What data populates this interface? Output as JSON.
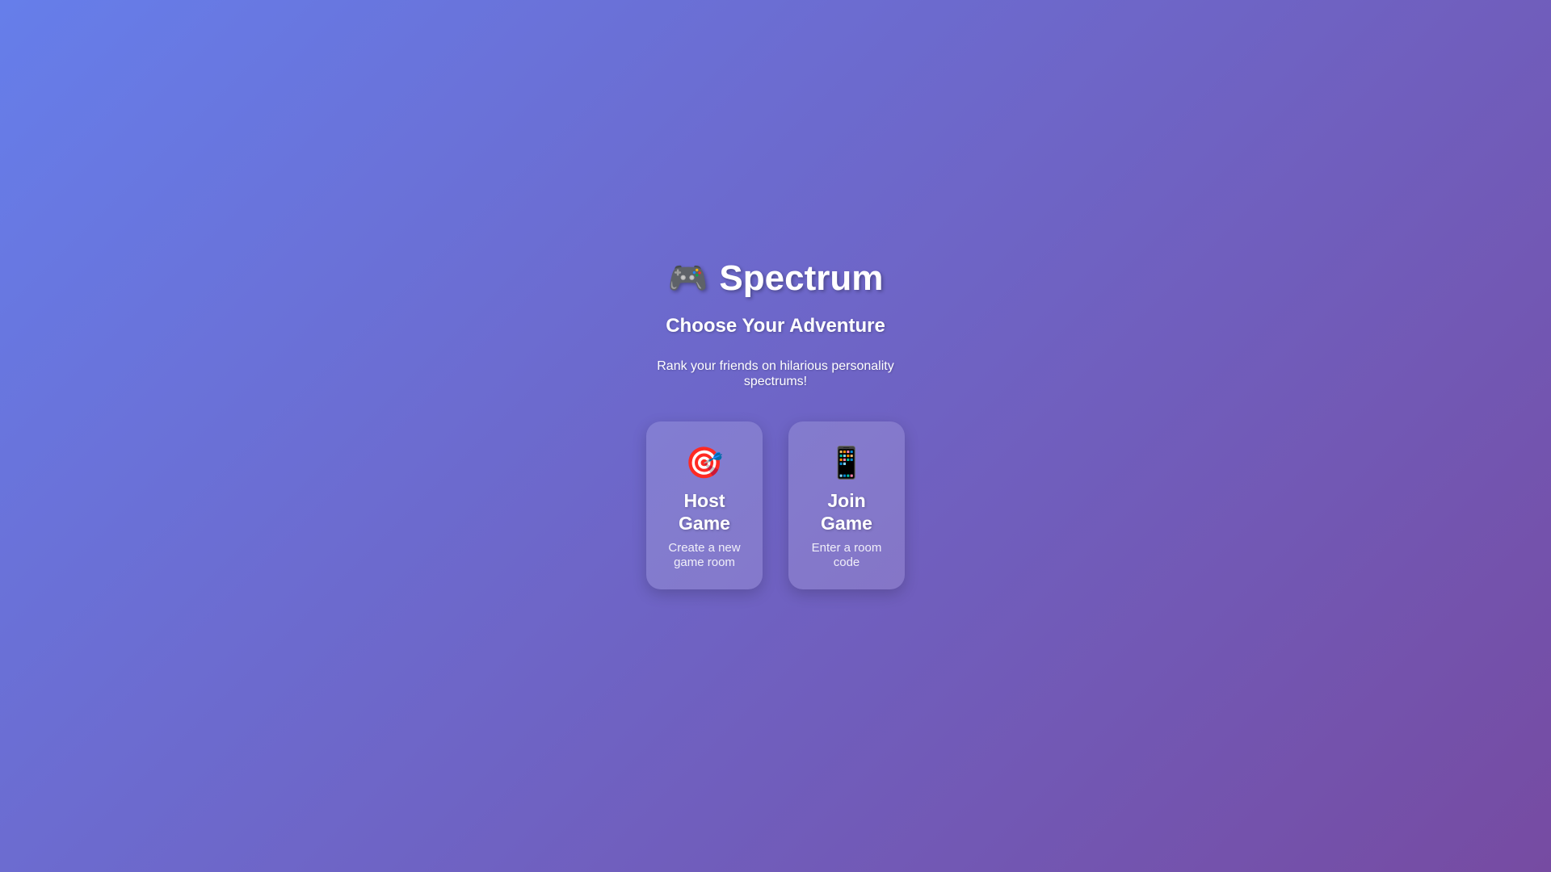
{
  "app": {
    "title": "Spectrum",
    "title_icon": "🎮",
    "title_icon_name": "game-controller-icon"
  },
  "header": {
    "subtitle": "Choose Your Adventure",
    "tagline": "Rank your friends on hilarious personality spectrums!"
  },
  "options": [
    {
      "icon": "🎯",
      "icon_name": "target-icon",
      "title": "Host Game",
      "description": "Create a new game room"
    },
    {
      "icon": "📱",
      "icon_name": "mobile-phone-icon",
      "title": "Join Game",
      "description": "Enter a room code"
    }
  ],
  "colors": {
    "background_start": "#667eea",
    "background_end": "#764ba2",
    "text": "#ffffff"
  }
}
